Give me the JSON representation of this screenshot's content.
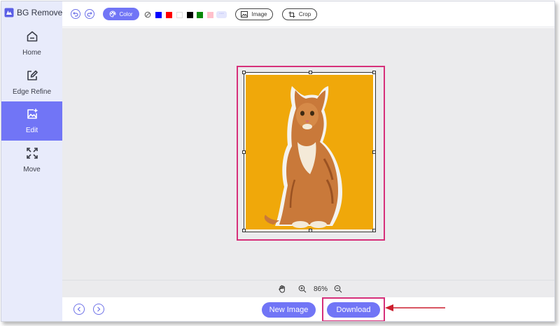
{
  "app": {
    "name": "BG Remover"
  },
  "sidebar": {
    "items": [
      {
        "label": "Home",
        "icon": "home-icon",
        "active": false
      },
      {
        "label": "Edge Refine",
        "icon": "edge-refine-icon",
        "active": false
      },
      {
        "label": "Edit",
        "icon": "edit-image-icon",
        "active": true
      },
      {
        "label": "Move",
        "icon": "move-icon",
        "active": false
      }
    ]
  },
  "toolbar": {
    "color_label": "Color",
    "image_label": "Image",
    "crop_label": "Crop",
    "swatches": [
      "#0000ff",
      "#ff0000",
      "#ffffff",
      "#000000",
      "#0a8a0a",
      "#ffc0cb"
    ],
    "more_label": "···"
  },
  "canvas": {
    "background_color": "#f0a80a"
  },
  "zoom": {
    "value": "86%"
  },
  "bottom": {
    "new_image_label": "New Image",
    "download_label": "Download"
  },
  "colors": {
    "accent": "#7175f6",
    "highlight": "#d6307a",
    "annotation_arrow": "#cc1f2e"
  }
}
